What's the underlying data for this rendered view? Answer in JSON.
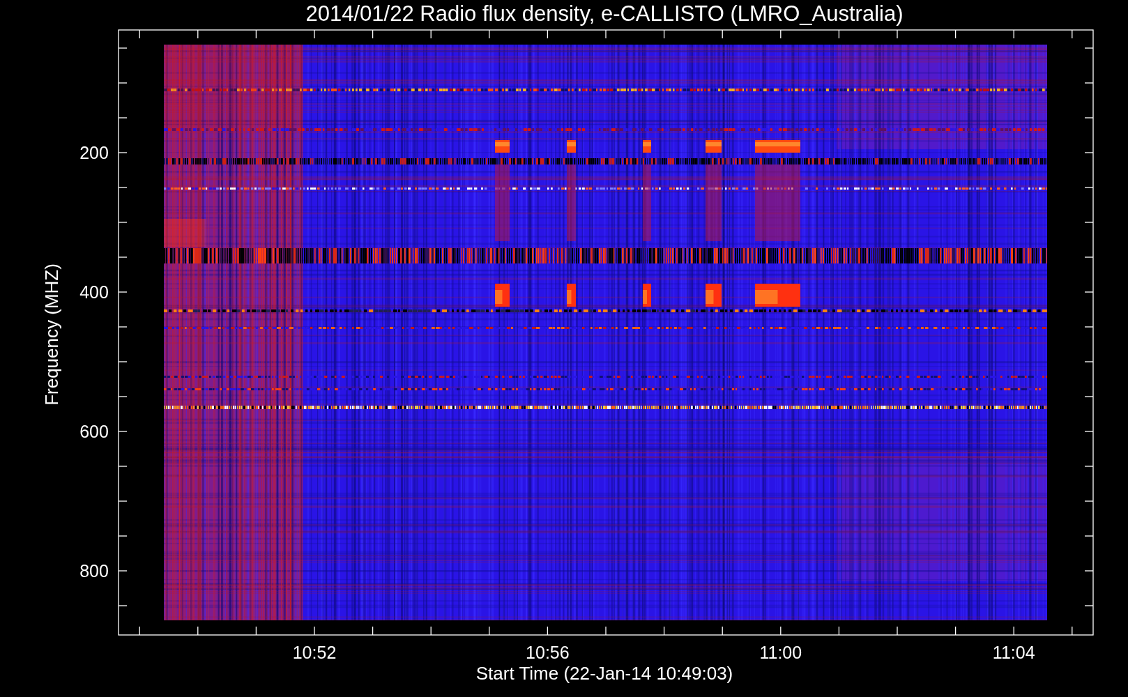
{
  "title": "2014/01/22  Radio flux density, e-CALLISTO (LMRO_Australia)",
  "y_axis": {
    "label": "Frequency (MHZ)",
    "ticks": [
      "200",
      "400",
      "600",
      "800"
    ]
  },
  "x_axis": {
    "label": "Start Time (22-Jan-14 10:49:03)",
    "ticks": [
      "10:52",
      "10:56",
      "11:00",
      "11:04"
    ]
  }
}
